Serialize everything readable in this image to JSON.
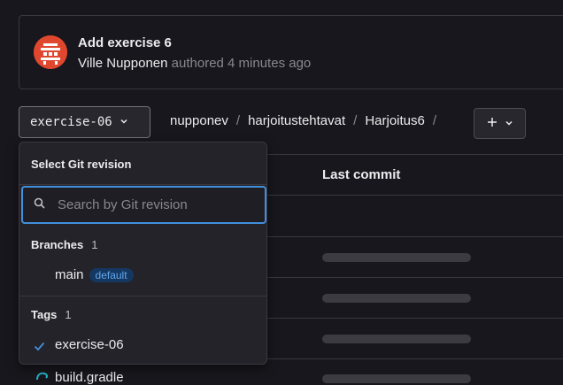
{
  "commit": {
    "title": "Add exercise 6",
    "author": "Ville Nupponen",
    "meta": "authored 4 minutes ago"
  },
  "ref_selector": {
    "label": "exercise-06",
    "icon": "chevron-down-icon"
  },
  "breadcrumb": {
    "items": [
      "nupponev",
      "harjoitustehtavat",
      "Harjoitus6"
    ],
    "separator": "/"
  },
  "add_button": {
    "label": "+",
    "icon": "chevron-down-icon"
  },
  "table": {
    "header_last_commit": "Last commit",
    "partial_file": "build.gradle"
  },
  "dropdown": {
    "title": "Select Git revision",
    "search_placeholder": "Search by Git revision",
    "branches": {
      "label": "Branches",
      "count": "1",
      "items": [
        {
          "name": "main",
          "badge": "default"
        }
      ]
    },
    "tags": {
      "label": "Tags",
      "count": "1",
      "items": [
        {
          "name": "exercise-06",
          "selected": true
        }
      ]
    }
  },
  "colors": {
    "background": "#18171d",
    "focus_blue": "#428fdc",
    "badge_text": "#63a6e9",
    "avatar": "#e0472f"
  }
}
